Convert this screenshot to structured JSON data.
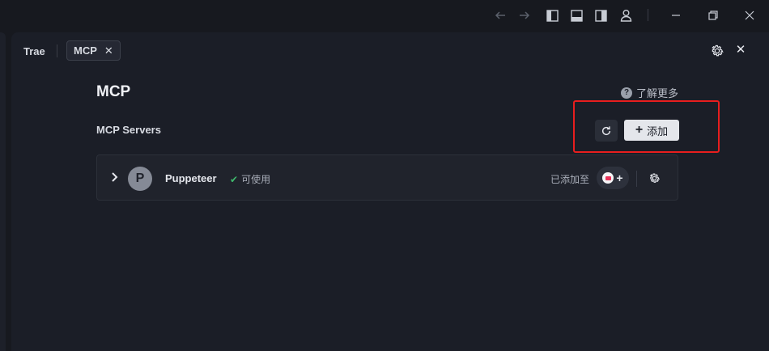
{
  "titlebar": {
    "icons": [
      "back-arrow-icon",
      "forward-arrow-icon",
      "sidebar-left-icon",
      "panel-bottom-icon",
      "sidebar-right-icon",
      "account-icon",
      "minimize-icon",
      "restore-icon",
      "close-icon"
    ]
  },
  "tabs": [
    {
      "label": "Trae",
      "active": false
    },
    {
      "label": "MCP",
      "active": true,
      "close": "✕"
    }
  ],
  "main": {
    "title": "MCP",
    "learn_more": "了解更多",
    "help_glyph": "?",
    "section_title": "MCP Servers",
    "add_button": "添加",
    "add_plus": "+"
  },
  "servers": [
    {
      "avatar_letter": "P",
      "name": "Puppeteer",
      "status": "可使用",
      "status_color": "#3fb96d",
      "added_label": "已添加至",
      "add_glyph": "+"
    }
  ],
  "colors": {
    "background": "#17191f",
    "panel": "#1b1e27",
    "card": "#20232c",
    "highlight": "#e81e1e",
    "add_button": "#e4e6eb"
  }
}
